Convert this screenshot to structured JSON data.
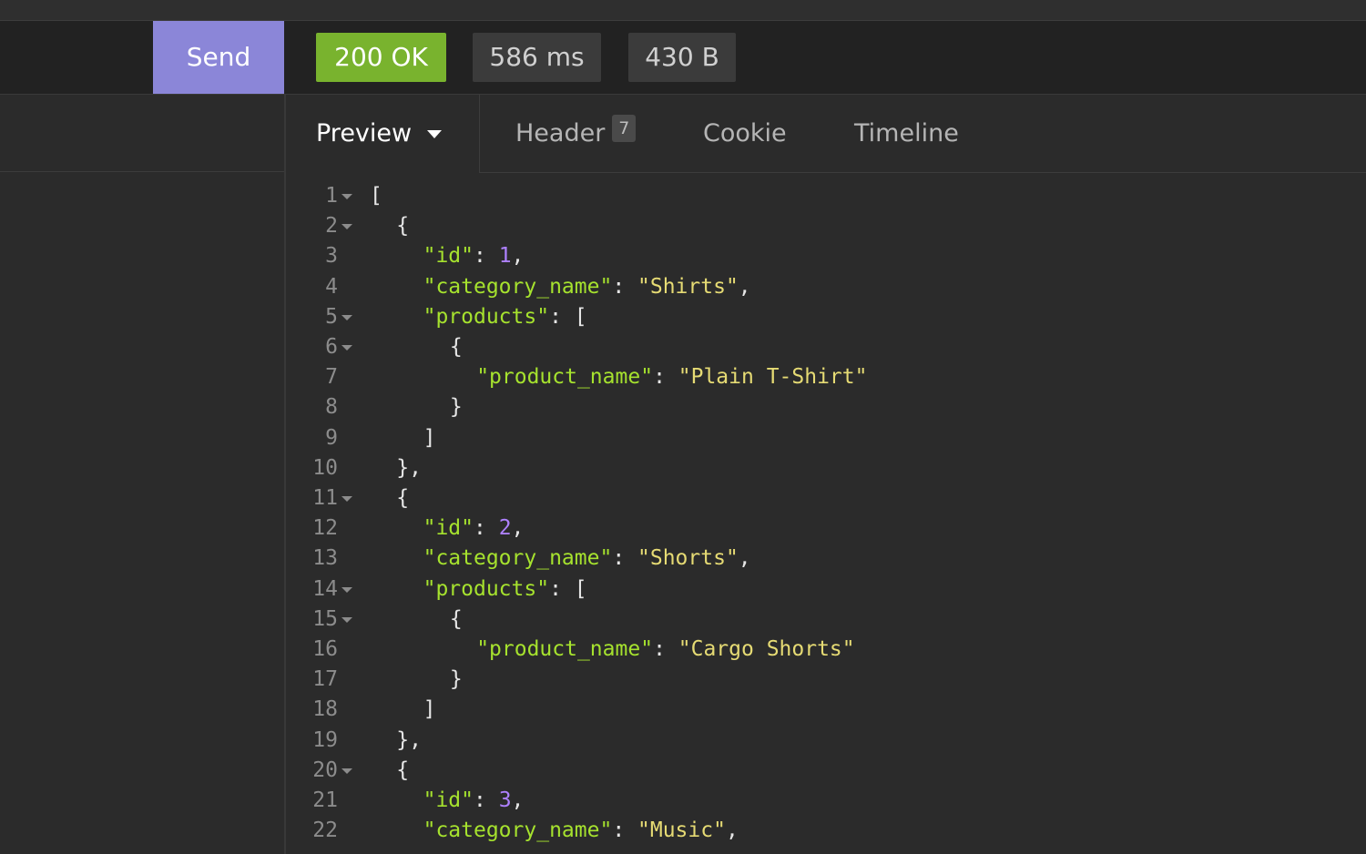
{
  "header": {
    "send_label": "Send",
    "status": "200 OK",
    "time": "586 ms",
    "size": "430 B",
    "status_color": "#79b32e",
    "send_color": "#8b86d8"
  },
  "tabs": {
    "preview": "Preview",
    "header": "Header",
    "header_count": "7",
    "cookie": "Cookie",
    "timeline": "Timeline"
  },
  "code_lines": [
    {
      "n": "1",
      "fold": true,
      "indent": 0,
      "tokens": [
        {
          "t": "punc",
          "v": "["
        }
      ]
    },
    {
      "n": "2",
      "fold": true,
      "indent": 1,
      "tokens": [
        {
          "t": "punc",
          "v": "{"
        }
      ]
    },
    {
      "n": "3",
      "fold": false,
      "indent": 2,
      "tokens": [
        {
          "t": "key",
          "v": "\"id\""
        },
        {
          "t": "punc",
          "v": ": "
        },
        {
          "t": "num",
          "v": "1"
        },
        {
          "t": "punc",
          "v": ","
        }
      ]
    },
    {
      "n": "4",
      "fold": false,
      "indent": 2,
      "tokens": [
        {
          "t": "key",
          "v": "\"category_name\""
        },
        {
          "t": "punc",
          "v": ": "
        },
        {
          "t": "str",
          "v": "\"Shirts\""
        },
        {
          "t": "punc",
          "v": ","
        }
      ]
    },
    {
      "n": "5",
      "fold": true,
      "indent": 2,
      "tokens": [
        {
          "t": "key",
          "v": "\"products\""
        },
        {
          "t": "punc",
          "v": ": ["
        }
      ]
    },
    {
      "n": "6",
      "fold": true,
      "indent": 3,
      "tokens": [
        {
          "t": "punc",
          "v": "{"
        }
      ]
    },
    {
      "n": "7",
      "fold": false,
      "indent": 4,
      "tokens": [
        {
          "t": "key",
          "v": "\"product_name\""
        },
        {
          "t": "punc",
          "v": ": "
        },
        {
          "t": "str",
          "v": "\"Plain T-Shirt\""
        }
      ]
    },
    {
      "n": "8",
      "fold": false,
      "indent": 3,
      "tokens": [
        {
          "t": "punc",
          "v": "}"
        }
      ]
    },
    {
      "n": "9",
      "fold": false,
      "indent": 2,
      "tokens": [
        {
          "t": "punc",
          "v": "]"
        }
      ]
    },
    {
      "n": "10",
      "fold": false,
      "indent": 1,
      "tokens": [
        {
          "t": "punc",
          "v": "},"
        }
      ]
    },
    {
      "n": "11",
      "fold": true,
      "indent": 1,
      "tokens": [
        {
          "t": "punc",
          "v": "{"
        }
      ]
    },
    {
      "n": "12",
      "fold": false,
      "indent": 2,
      "tokens": [
        {
          "t": "key",
          "v": "\"id\""
        },
        {
          "t": "punc",
          "v": ": "
        },
        {
          "t": "num",
          "v": "2"
        },
        {
          "t": "punc",
          "v": ","
        }
      ]
    },
    {
      "n": "13",
      "fold": false,
      "indent": 2,
      "tokens": [
        {
          "t": "key",
          "v": "\"category_name\""
        },
        {
          "t": "punc",
          "v": ": "
        },
        {
          "t": "str",
          "v": "\"Shorts\""
        },
        {
          "t": "punc",
          "v": ","
        }
      ]
    },
    {
      "n": "14",
      "fold": true,
      "indent": 2,
      "tokens": [
        {
          "t": "key",
          "v": "\"products\""
        },
        {
          "t": "punc",
          "v": ": ["
        }
      ]
    },
    {
      "n": "15",
      "fold": true,
      "indent": 3,
      "tokens": [
        {
          "t": "punc",
          "v": "{"
        }
      ]
    },
    {
      "n": "16",
      "fold": false,
      "indent": 4,
      "tokens": [
        {
          "t": "key",
          "v": "\"product_name\""
        },
        {
          "t": "punc",
          "v": ": "
        },
        {
          "t": "str",
          "v": "\"Cargo Shorts\""
        }
      ]
    },
    {
      "n": "17",
      "fold": false,
      "indent": 3,
      "tokens": [
        {
          "t": "punc",
          "v": "}"
        }
      ]
    },
    {
      "n": "18",
      "fold": false,
      "indent": 2,
      "tokens": [
        {
          "t": "punc",
          "v": "]"
        }
      ]
    },
    {
      "n": "19",
      "fold": false,
      "indent": 1,
      "tokens": [
        {
          "t": "punc",
          "v": "},"
        }
      ]
    },
    {
      "n": "20",
      "fold": true,
      "indent": 1,
      "tokens": [
        {
          "t": "punc",
          "v": "{"
        }
      ]
    },
    {
      "n": "21",
      "fold": false,
      "indent": 2,
      "tokens": [
        {
          "t": "key",
          "v": "\"id\""
        },
        {
          "t": "punc",
          "v": ": "
        },
        {
          "t": "num",
          "v": "3"
        },
        {
          "t": "punc",
          "v": ","
        }
      ]
    },
    {
      "n": "22",
      "fold": false,
      "indent": 2,
      "tokens": [
        {
          "t": "key",
          "v": "\"category_name\""
        },
        {
          "t": "punc",
          "v": ": "
        },
        {
          "t": "str",
          "v": "\"Music\""
        },
        {
          "t": "punc",
          "v": ","
        }
      ]
    }
  ]
}
